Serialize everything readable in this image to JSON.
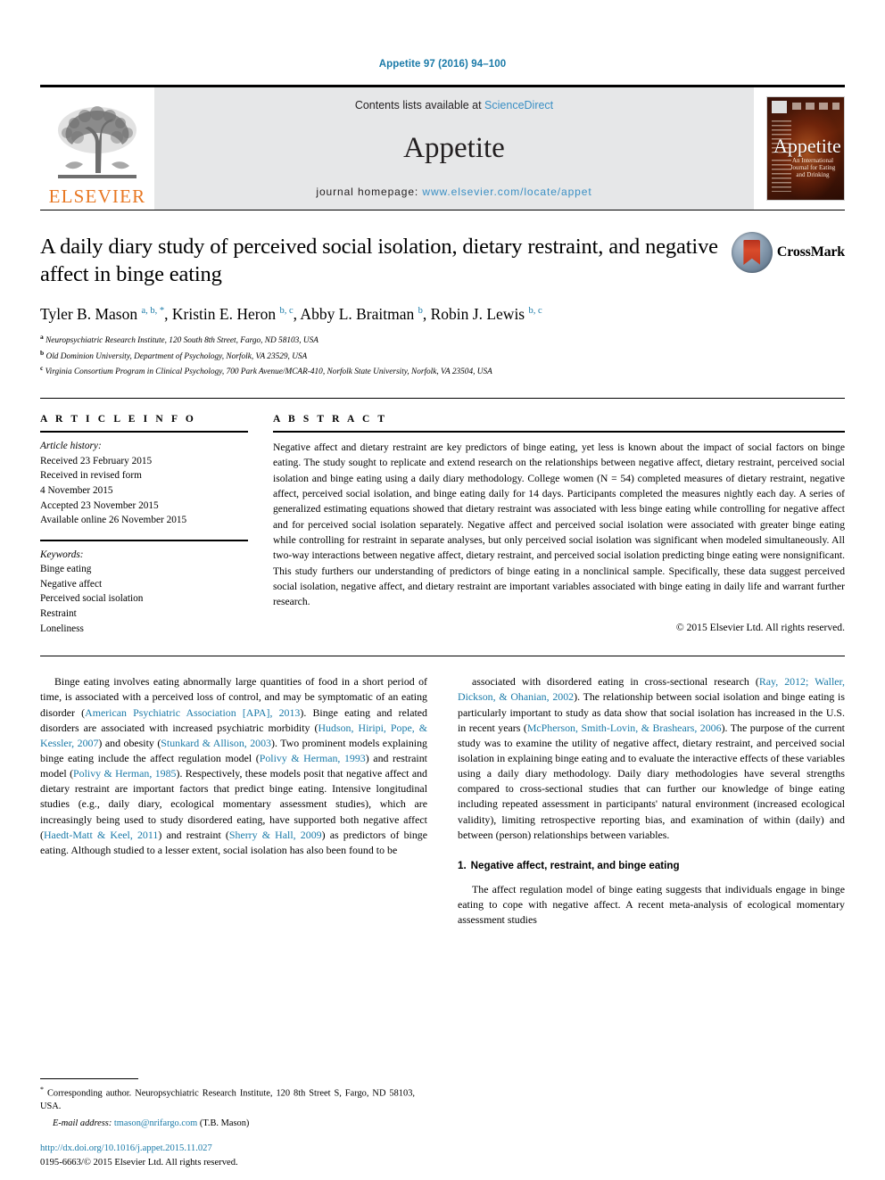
{
  "running_head": "Appetite 97 (2016) 94–100",
  "banner": {
    "publisher_name": "ELSEVIER",
    "contents_prefix": "Contents lists available at ",
    "contents_link": "ScienceDirect",
    "journal_name": "Appetite",
    "homepage_prefix": "journal homepage: ",
    "homepage_url": "www.elsevier.com/locate/appet",
    "cover_title": "Appetite",
    "cover_subtitle": "An International Journal for Eating and Drinking"
  },
  "article": {
    "title": "A daily diary study of perceived social isolation, dietary restraint, and negative affect in binge eating",
    "crossmark_label": "CrossMark",
    "authors_html": "Tyler B. Mason <sup>a, b, *</sup>, Kristin E. Heron <sup>b, c</sup>, Abby L. Braitman <sup>b</sup>, Robin J. Lewis <sup>b, c</sup>",
    "affiliations": [
      {
        "mark": "a",
        "text": "Neuropsychiatric Research Institute, 120 South 8th Street, Fargo, ND 58103, USA"
      },
      {
        "mark": "b",
        "text": "Old Dominion University, Department of Psychology, Norfolk, VA 23529, USA"
      },
      {
        "mark": "c",
        "text": "Virginia Consortium Program in Clinical Psychology, 700 Park Avenue/MCAR-410, Norfolk State University, Norfolk, VA 23504, USA"
      }
    ]
  },
  "article_info": {
    "heading": "A R T I C L E   I N F O",
    "history_label": "Article history:",
    "history": [
      "Received 23 February 2015",
      "Received in revised form",
      "4 November 2015",
      "Accepted 23 November 2015",
      "Available online 26 November 2015"
    ],
    "keywords_label": "Keywords:",
    "keywords": [
      "Binge eating",
      "Negative affect",
      "Perceived social isolation",
      "Restraint",
      "Loneliness"
    ]
  },
  "abstract": {
    "heading": "A B S T R A C T",
    "text": "Negative affect and dietary restraint are key predictors of binge eating, yet less is known about the impact of social factors on binge eating. The study sought to replicate and extend research on the relationships between negative affect, dietary restraint, perceived social isolation and binge eating using a daily diary methodology. College women (N = 54) completed measures of dietary restraint, negative affect, perceived social isolation, and binge eating daily for 14 days. Participants completed the measures nightly each day. A series of generalized estimating equations showed that dietary restraint was associated with less binge eating while controlling for negative affect and for perceived social isolation separately. Negative affect and perceived social isolation were associated with greater binge eating while controlling for restraint in separate analyses, but only perceived social isolation was significant when modeled simultaneously. All two-way interactions between negative affect, dietary restraint, and perceived social isolation predicting binge eating were nonsignificant. This study furthers our understanding of predictors of binge eating in a nonclinical sample. Specifically, these data suggest perceived social isolation, negative affect, and dietary restraint are important variables associated with binge eating in daily life and warrant further research.",
    "copyright": "© 2015 Elsevier Ltd. All rights reserved."
  },
  "body": {
    "left_paragraph_1_html": "Binge eating involves eating abnormally large quantities of food in a short period of time, is associated with a perceived loss of control, and may be symptomatic of an eating disorder (<span class=\"ref\">American Psychiatric Association [APA], 2013</span>). Binge eating and related disorders are associated with increased psychiatric morbidity (<span class=\"ref\">Hudson, Hiripi, Pope, &amp; Kessler, 2007</span>) and obesity (<span class=\"ref\">Stunkard &amp; Allison, 2003</span>). Two prominent models explaining binge eating include the affect regulation model (<span class=\"ref\">Polivy &amp; Herman, 1993</span>) and restraint model (<span class=\"ref\">Polivy &amp; Herman, 1985</span>). Respectively, these models posit that negative affect and dietary restraint are important factors that predict binge eating. Intensive longitudinal studies (e.g., daily diary, ecological momentary assessment studies), which are increasingly being used to study disordered eating, have supported both negative affect (<span class=\"ref\">Haedt-Matt &amp; Keel, 2011</span>) and restraint (<span class=\"ref\">Sherry &amp; Hall, 2009</span>) as predictors of binge eating. Although studied to a lesser extent, social isolation has also been found to be",
    "right_paragraph_1_html": "associated with disordered eating in cross-sectional research (<span class=\"ref\">Ray, 2012; Waller, Dickson, &amp; Ohanian, 2002</span>). The relationship between social isolation and binge eating is particularly important to study as data show that social isolation has increased in the U.S. in recent years (<span class=\"ref\">McPherson, Smith-Lovin, &amp; Brashears, 2006</span>). The purpose of the current study was to examine the utility of negative affect, dietary restraint, and perceived social isolation in explaining binge eating and to evaluate the interactive effects of these variables using a daily diary methodology. Daily diary methodologies have several strengths compared to cross-sectional studies that can further our knowledge of binge eating including repeated assessment in participants' natural environment (increased ecological validity), limiting retrospective reporting bias, and examination of within (daily) and between (person) relationships between variables.",
    "section_number": "1.",
    "section_title": "Negative affect, restraint, and binge eating",
    "right_paragraph_2_html": "The affect regulation model of binge eating suggests that individuals engage in binge eating to cope with negative affect. A recent meta-analysis of ecological momentary assessment studies"
  },
  "footnote": {
    "corresponding_html": "<span class=\"star\">*</span> Corresponding author. Neuropsychiatric Research Institute, 120 8th Street S, Fargo, ND 58103, USA.",
    "email_label": "E-mail address:",
    "email": "tmason@nrifargo.com",
    "email_owner": "(T.B. Mason)"
  },
  "footer": {
    "doi": "http://dx.doi.org/10.1016/j.appet.2015.11.027",
    "issn_line": "0195-6663/© 2015 Elsevier Ltd. All rights reserved."
  },
  "colors": {
    "link": "#1a7aa8",
    "elsevier_orange": "#e87722",
    "banner_gray": "#e6e7e8"
  }
}
